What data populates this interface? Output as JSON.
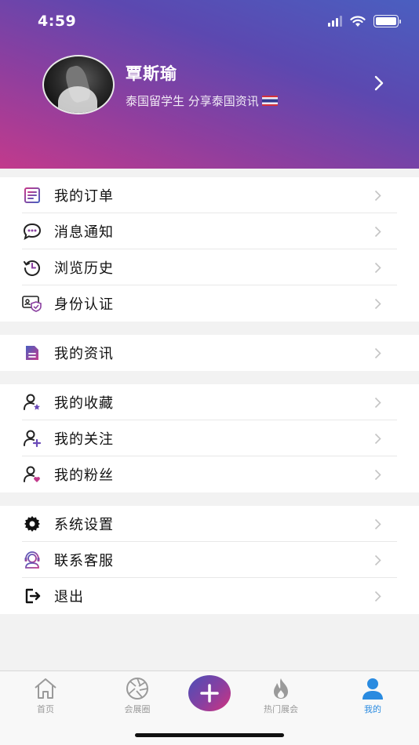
{
  "status_bar": {
    "time": "4:59"
  },
  "profile": {
    "name": "覃斯瑜",
    "bio": "泰国留学生 分享泰国资讯"
  },
  "menu_groups": [
    [
      {
        "label": "我的订单",
        "icon": "order-list-icon"
      },
      {
        "label": "消息通知",
        "icon": "message-bubble-icon"
      },
      {
        "label": "浏览历史",
        "icon": "history-clock-icon"
      },
      {
        "label": "身份认证",
        "icon": "id-verification-icon"
      }
    ],
    [
      {
        "label": "我的资讯",
        "icon": "document-icon"
      }
    ],
    [
      {
        "label": "我的收藏",
        "icon": "user-star-icon"
      },
      {
        "label": "我的关注",
        "icon": "user-plus-icon"
      },
      {
        "label": "我的粉丝",
        "icon": "user-heart-icon"
      }
    ],
    [
      {
        "label": "系统设置",
        "icon": "gear-icon"
      },
      {
        "label": "联系客服",
        "icon": "customer-service-icon"
      },
      {
        "label": "退出",
        "icon": "logout-icon"
      }
    ]
  ],
  "tabbar": {
    "items": [
      {
        "label": "首页",
        "icon": "home-icon"
      },
      {
        "label": "会展圈",
        "icon": "aperture-icon"
      },
      {
        "label": "",
        "icon": "plus-icon"
      },
      {
        "label": "热门展会",
        "icon": "flame-icon"
      },
      {
        "label": "我的",
        "icon": "person-icon"
      }
    ],
    "active": "我的"
  },
  "colors": {
    "accent_blue": "#2a8be0",
    "gradient_pink": "#c23a8c",
    "gradient_blue": "#4a5fc0"
  }
}
